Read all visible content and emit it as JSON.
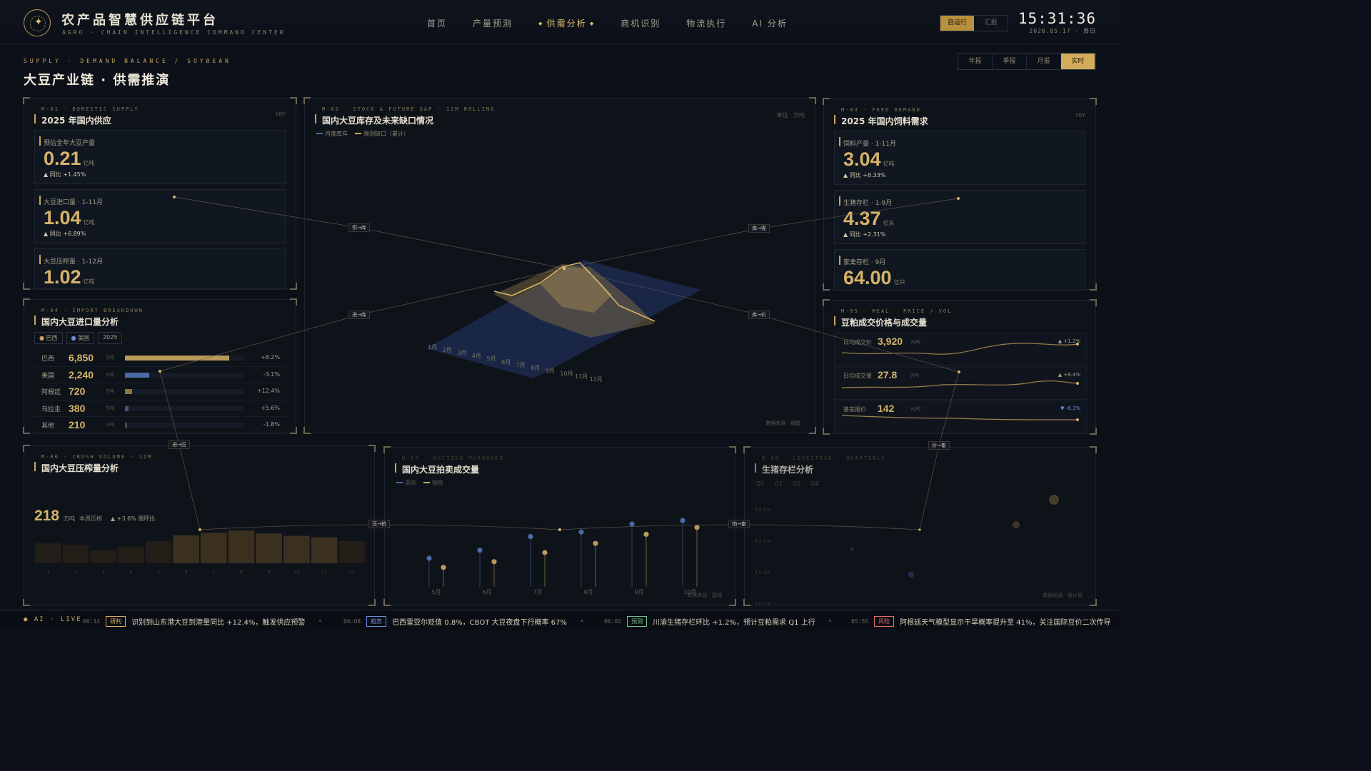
{
  "header": {
    "title": "农产品智慧供应链平台",
    "subtitle": "AGRO · CHAIN INTELLIGENCE COMMAND CENTER",
    "nav": [
      "首页",
      "产量预测",
      "供需分析",
      "商机识别",
      "物流执行",
      "AI 分析"
    ],
    "active_nav": 2,
    "mode": [
      "自运行",
      "汇报"
    ],
    "time": "15:31:36",
    "date": "2026.05.17 · 周日"
  },
  "section": {
    "en": "SUPPLY · DEMAND BALANCE / SOYBEAN",
    "cn": "大豆产业链 · 供需推演",
    "periods": [
      "年报",
      "季报",
      "月报",
      "实时"
    ],
    "active_period": 3
  },
  "m01": {
    "tag": "M-01 · DOMESTIC SUPPLY",
    "title": "2025 年国内供应",
    "right": "YOY",
    "cards": [
      {
        "label": "预估全年大豆产量",
        "value": "0.21",
        "unit": "亿吨",
        "change": "▲ 同比 +1.45%"
      },
      {
        "label": "大豆进口量 · 1-11月",
        "value": "1.04",
        "unit": "亿吨",
        "change": "▲ 同比 +6.89%"
      },
      {
        "label": "大豆压榨量 · 1-12月",
        "value": "1.02",
        "unit": "亿吨",
        "change": ""
      }
    ]
  },
  "m02": {
    "tag": "M-02 · STOCK & FUTURE GAP · 12M ROLLING",
    "title": "国内大豆库存及未来缺口情况",
    "right": "单位 · 万吨",
    "legend": [
      "月度库存",
      "预测缺口（累计）"
    ],
    "months": [
      "1月",
      "2月",
      "3月",
      "4月",
      "5月",
      "6月",
      "7月",
      "8月",
      "9月",
      "10月",
      "11月",
      "12月"
    ],
    "source": "数据来源 · 钢联"
  },
  "m03": {
    "tag": "M-03 · FEED DEMAND",
    "title": "2025 年国内饲料需求",
    "right": "YOY",
    "cards": [
      {
        "label": "饲料产量 · 1-11月",
        "value": "3.04",
        "unit": "亿吨",
        "change": "▲ 同比 +8.33%"
      },
      {
        "label": "生猪存栏 · 1-9月",
        "value": "4.37",
        "unit": "亿头",
        "change": "▲ 同比 +2.31%"
      },
      {
        "label": "家禽存栏 · 9月",
        "value": "64.00",
        "unit": "亿只",
        "change": ""
      }
    ]
  },
  "m04": {
    "tag": "M-04 · IMPORT BREAKDOWN",
    "title": "国内大豆进口量分析",
    "filters": [
      "巴西",
      "美国",
      "2025"
    ],
    "unit": "万吨",
    "rows": [
      {
        "name": "巴西",
        "value": "6,850",
        "pct": 0.85,
        "change": "+8.2%",
        "color": "#b89a5a"
      },
      {
        "name": "美国",
        "value": "2,240",
        "pct": 0.2,
        "change": "-3.1%",
        "color": "#4a6aa8"
      },
      {
        "name": "阿根廷",
        "value": "720",
        "pct": 0.06,
        "change": "+12.4%",
        "color": "#8c7444"
      },
      {
        "name": "乌拉圭",
        "value": "380",
        "pct": 0.03,
        "change": "+5.6%",
        "color": "#3d5484"
      },
      {
        "name": "其他",
        "value": "210",
        "pct": 0.015,
        "change": "-1.8%",
        "color": "#4d4a42"
      }
    ]
  },
  "m05": {
    "tag": "M-05 · MEAL · PRICE / VOL",
    "title": "豆粕成交价格与成交量",
    "rows": [
      {
        "label": "日均成交价",
        "value": "3,920",
        "unit": "元/吨",
        "change": "▲ +1.2%"
      },
      {
        "label": "日均成交量",
        "value": "27.8",
        "unit": "万吨",
        "change": "▲ +8.4%"
      },
      {
        "label": "基差报价",
        "value": "142",
        "unit": "元/吨",
        "change": "▼ -6.3%"
      }
    ]
  },
  "m06": {
    "tag": "M-06 · CRUSH VOLUME · 12M",
    "title": "国内大豆压榨量分析",
    "value": "218",
    "unit": "万吨",
    "note": "本周压榨",
    "change": "▲ +3.6% 周环比",
    "months": [
      "1",
      "2",
      "3",
      "4",
      "5",
      "6",
      "7",
      "8",
      "9",
      "10",
      "11",
      "12"
    ],
    "values": [
      0.55,
      0.5,
      0.35,
      0.45,
      0.6,
      0.75,
      0.82,
      0.88,
      0.8,
      0.74,
      0.7,
      0.6
    ]
  },
  "m07": {
    "tag": "M-07 · AUCTION TURNOVER",
    "title": "国内大豆拍卖成交量",
    "legend": [
      "采购",
      "销售"
    ],
    "months": [
      "5月",
      "6月",
      "7月",
      "8月",
      "9月",
      "10月"
    ],
    "source": "数据来源 · 国储"
  },
  "m08": {
    "tag": "M-08 · LIVESTOCK · QUARTERLY",
    "title": "生猪存栏分析",
    "legend": [
      "Q1",
      "Q2",
      "Q3",
      "Q4"
    ],
    "ylabels": [
      "4.8·10k",
      "4.4·10k",
      "4.0·10k",
      "3.6·10k"
    ],
    "source": "数据来源 · 统计局"
  },
  "flows": [
    "供→库",
    "库→需",
    "进→库",
    "库→价",
    "进→压",
    "价→畜",
    "压→拍",
    "拍→畜"
  ],
  "ticker": {
    "label": "AI · LIVE",
    "items": [
      {
        "time": "06:14",
        "tag": "研判",
        "tagColor": "#d4ad5c",
        "msg": "识别到山东港大豆到港量同比 +12.4%，触发供应预警"
      },
      {
        "time": "06:08",
        "tag": "趋势",
        "tagColor": "#6d8fd8",
        "msg": "巴西雷亚尔贬值 0.8%，CBOT 大豆夜盘下行概率 67%"
      },
      {
        "time": "06:02",
        "tag": "预测",
        "tagColor": "#6fc48a",
        "msg": "川渝生猪存栏环比 +1.2%，预计豆粕需求 Q1 上行"
      },
      {
        "time": "05:55",
        "tag": "风险",
        "tagColor": "#e06a6a",
        "msg": "阿根廷天气模型显示干旱概率提升至 41%，关注国际豆价二次传导"
      }
    ]
  }
}
